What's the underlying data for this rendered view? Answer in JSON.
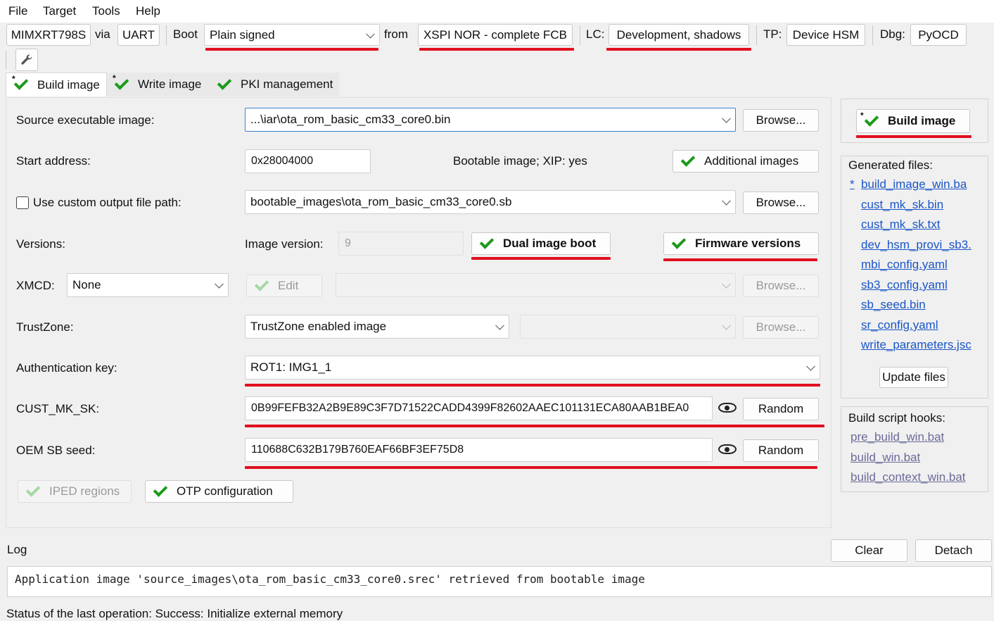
{
  "menu": [
    "File",
    "Target",
    "Tools",
    "Help"
  ],
  "toolbar": {
    "device": "MIMXRT798S",
    "via_label": "via",
    "connection": "UART",
    "boot_label": "Boot",
    "boot_type": "Plain signed",
    "from_label": "from",
    "boot_memory": "XSPI NOR - complete FCB",
    "lc_label": "LC:",
    "lifecycle": "Development, shadows",
    "tp_label": "TP:",
    "trust_provisioning": "Device HSM",
    "dbg_label": "Dbg:",
    "debug_probe": "PyOCD"
  },
  "tabs": [
    {
      "label": "Build image",
      "starred": true
    },
    {
      "label": "Write image",
      "starred": true
    },
    {
      "label": "PKI management",
      "starred": false
    }
  ],
  "form": {
    "source_label": "Source executable image:",
    "source_value": "...\\iar\\ota_rom_basic_cm33_core0.bin",
    "browse_label": "Browse...",
    "start_label": "Start address:",
    "start_value": "0x28004000",
    "bootable_info": "Bootable image; XIP: yes",
    "additional_images": "Additional images",
    "custom_output_label": "Use custom output file path:",
    "custom_output_checked": false,
    "output_value": "bootable_images\\ota_rom_basic_cm33_core0.sb",
    "versions_label": "Versions:",
    "image_version_label": "Image version:",
    "image_version_value": "9",
    "dual_image_boot": "Dual image boot",
    "firmware_versions": "Firmware versions",
    "xmcd_label": "XMCD:",
    "xmcd_value": "None",
    "edit_label": "Edit",
    "trustzone_label": "TrustZone:",
    "trustzone_value": "TrustZone enabled image",
    "auth_key_label": "Authentication key:",
    "auth_key_value": "ROT1: IMG1_1",
    "cust_mk_sk_label": "CUST_MK_SK:",
    "cust_mk_sk_value": "0B99FEFB32A2B9E89C3F7D71522CADD4399F82602AAEC101131ECA80AAB1BEA0",
    "random_label": "Random",
    "oem_sb_seed_label": "OEM SB seed:",
    "oem_sb_seed_value": "110688C632B179B760EAF66BF3EF75D8",
    "iped_regions": "IPED regions",
    "otp_configuration": "OTP configuration"
  },
  "right": {
    "build_image": "Build image",
    "generated_files_label": "Generated files:",
    "generated_files": [
      "build_image_win.ba",
      "cust_mk_sk.bin",
      "cust_mk_sk.txt",
      "dev_hsm_provi_sb3.",
      "mbi_config.yaml",
      "sb3_config.yaml",
      "sb_seed.bin",
      "sr_config.yaml",
      "write_parameters.jsc"
    ],
    "generated_star": "*",
    "update_files": "Update files",
    "hooks_label": "Build script hooks:",
    "hooks": [
      "pre_build_win.bat",
      "build_win.bat",
      "build_context_win.bat"
    ]
  },
  "log": {
    "label": "Log",
    "clear": "Clear",
    "detach": "Detach",
    "text": "Application image 'source_images\\ota_rom_basic_cm33_core0.srec' retrieved from bootable image"
  },
  "status": "Status of the last operation: Success: Initialize external memory",
  "colors": {
    "accent_underline": "#e0101f",
    "check_green": "#1a9b1a",
    "link_blue": "#1a56c8"
  }
}
